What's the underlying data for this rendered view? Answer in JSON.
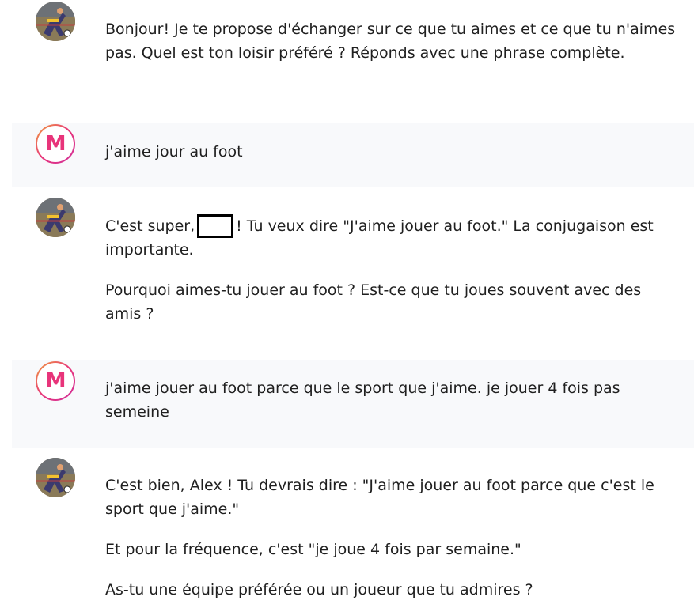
{
  "conversation": {
    "messages": [
      {
        "role": "bot",
        "paragraphs": [
          "Bonjour! Je te propose d'échanger sur ce que tu aimes et ce que tu n'aimes pas. Quel est ton loisir préféré ? Réponds avec une phrase complète."
        ]
      },
      {
        "role": "user",
        "avatar_letter": "M",
        "paragraphs": [
          "j'aime jour au foot"
        ]
      },
      {
        "role": "bot",
        "paragraphs_before_redaction": "C'est super,",
        "paragraphs_after_redaction": "! Tu veux dire \"J'aime jouer au foot.\" La conjugaison est importante.",
        "paragraphs": [
          "Pourquoi aimes-tu jouer au foot ? Est-ce que tu joues souvent avec des amis ?"
        ]
      },
      {
        "role": "user",
        "avatar_letter": "M",
        "paragraphs": [
          "j'aime jouer au foot parce que le sport que j'aime. je jouer 4 fois pas semeine"
        ]
      },
      {
        "role": "bot",
        "paragraphs": [
          "C'est bien, Alex ! Tu devrais dire : \"J'aime jouer au foot parce que c'est le sport que j'aime.\"",
          "Et pour la fréquence, c'est \"je joue 4 fois par semaine.\"",
          "As-tu une équipe préférée ou un joueur que tu admires ?"
        ]
      }
    ]
  },
  "colors": {
    "user_row_background": "#f8f9fb",
    "logo_pink": "#e8347a",
    "logo_orange": "#f0a23c"
  }
}
